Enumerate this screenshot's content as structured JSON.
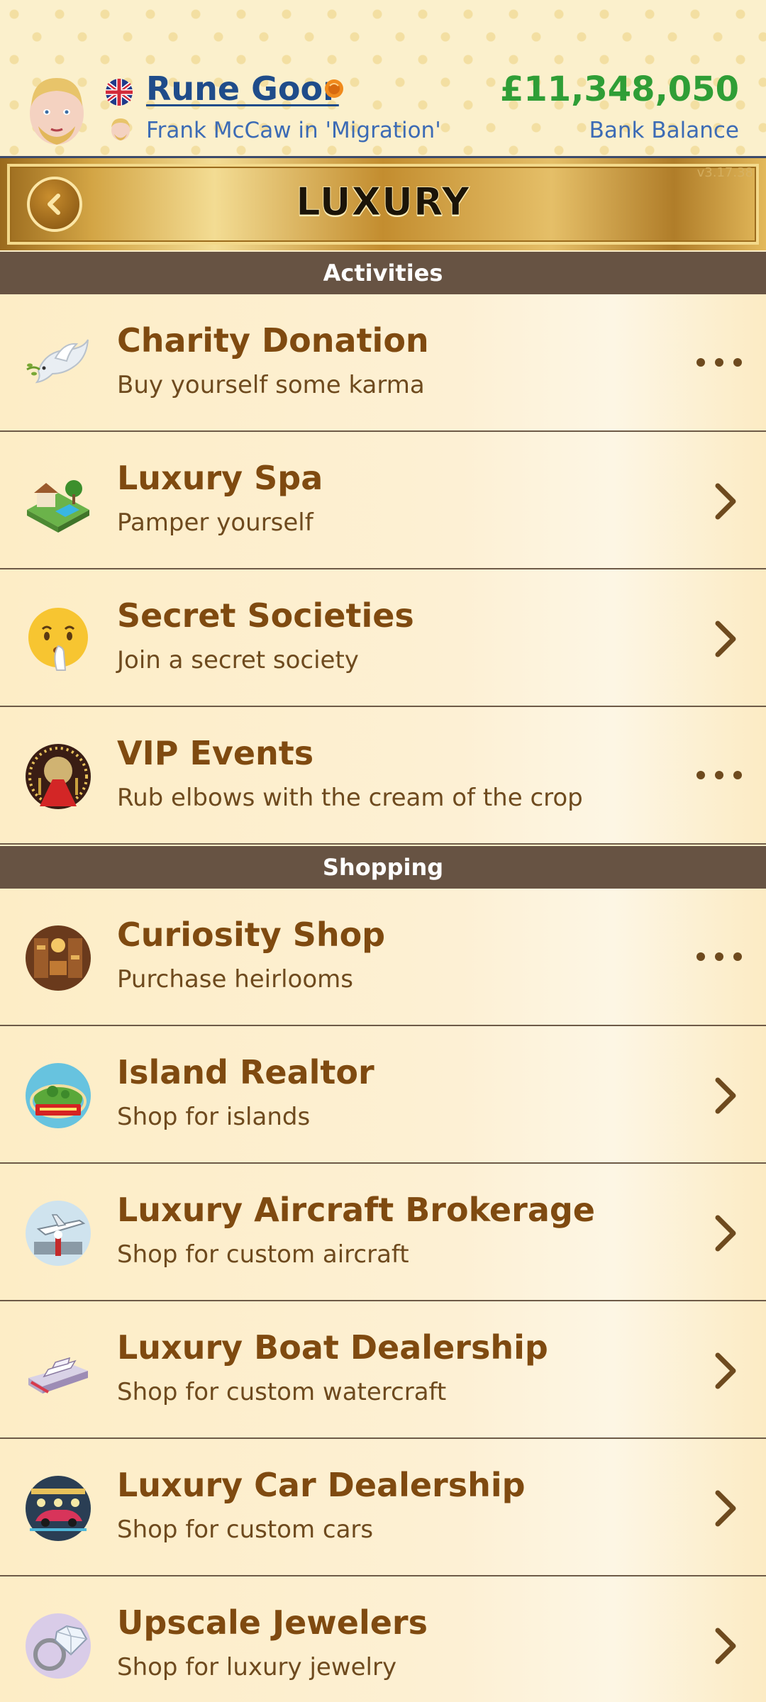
{
  "header": {
    "player_name": "Rune Goor",
    "subtitle": "Frank McCaw in 'Migration'",
    "balance": "£11,348,050",
    "balance_label": "Bank Balance"
  },
  "banner": {
    "title": "LUXURY",
    "version": "v3.17.38"
  },
  "sections": [
    {
      "title": "Activities",
      "items": [
        {
          "title": "Charity Donation",
          "desc": "Buy yourself some karma",
          "action": "more",
          "icon": "dove-icon"
        },
        {
          "title": "Luxury Spa",
          "desc": "Pamper yourself",
          "action": "chevron",
          "icon": "spa-villa-icon"
        },
        {
          "title": "Secret Societies",
          "desc": "Join a secret society",
          "action": "chevron",
          "icon": "shushing-face-icon"
        },
        {
          "title": "VIP Events",
          "desc": "Rub elbows with the cream of the crop",
          "action": "more",
          "icon": "red-carpet-icon"
        }
      ]
    },
    {
      "title": "Shopping",
      "items": [
        {
          "title": "Curiosity Shop",
          "desc": "Purchase heirlooms",
          "action": "more",
          "icon": "antique-shop-icon"
        },
        {
          "title": "Island Realtor",
          "desc": "Shop for islands",
          "action": "chevron",
          "icon": "island-for-sale-icon"
        },
        {
          "title": "Luxury Aircraft Brokerage",
          "desc": "Shop for custom aircraft",
          "action": "chevron",
          "icon": "private-jet-icon"
        },
        {
          "title": "Luxury Boat Dealership",
          "desc": "Shop for custom watercraft",
          "action": "chevron",
          "icon": "yacht-icon"
        },
        {
          "title": "Luxury Car Dealership",
          "desc": "Shop for custom cars",
          "action": "chevron",
          "icon": "car-showroom-icon"
        },
        {
          "title": "Upscale Jewelers",
          "desc": "Shop for luxury jewelry",
          "action": "chevron",
          "icon": "diamond-ring-icon"
        }
      ]
    }
  ],
  "colors": {
    "section_bg": "#675343",
    "title_text": "#7f4a10",
    "balance": "#2f9e36",
    "link_blue": "#1f4c8a"
  }
}
